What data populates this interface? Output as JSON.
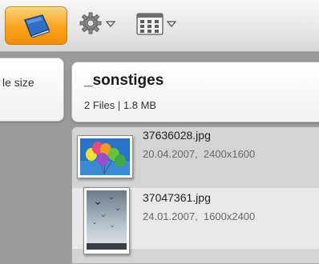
{
  "toolbar": {
    "library_icon": "blue-book-icon",
    "settings_icon": "gear-icon",
    "view_icon": "grid-view-icon"
  },
  "left_pane": {
    "header_text": "le size"
  },
  "folder": {
    "name": "_sonstiges",
    "summary": "2 Files | 1.8 MB"
  },
  "files": [
    {
      "name": "37636028.jpg",
      "date": "20.04.2007,",
      "dimensions": "2400x1600",
      "thumbnail": "balloons-photo"
    },
    {
      "name": "37047361.jpg",
      "date": "24.01.2007,",
      "dimensions": "1600x2400",
      "thumbnail": "birds-sky-photo"
    }
  ],
  "colors": {
    "accent": "#f7a21c",
    "book_blue": "#2f6fc7"
  }
}
